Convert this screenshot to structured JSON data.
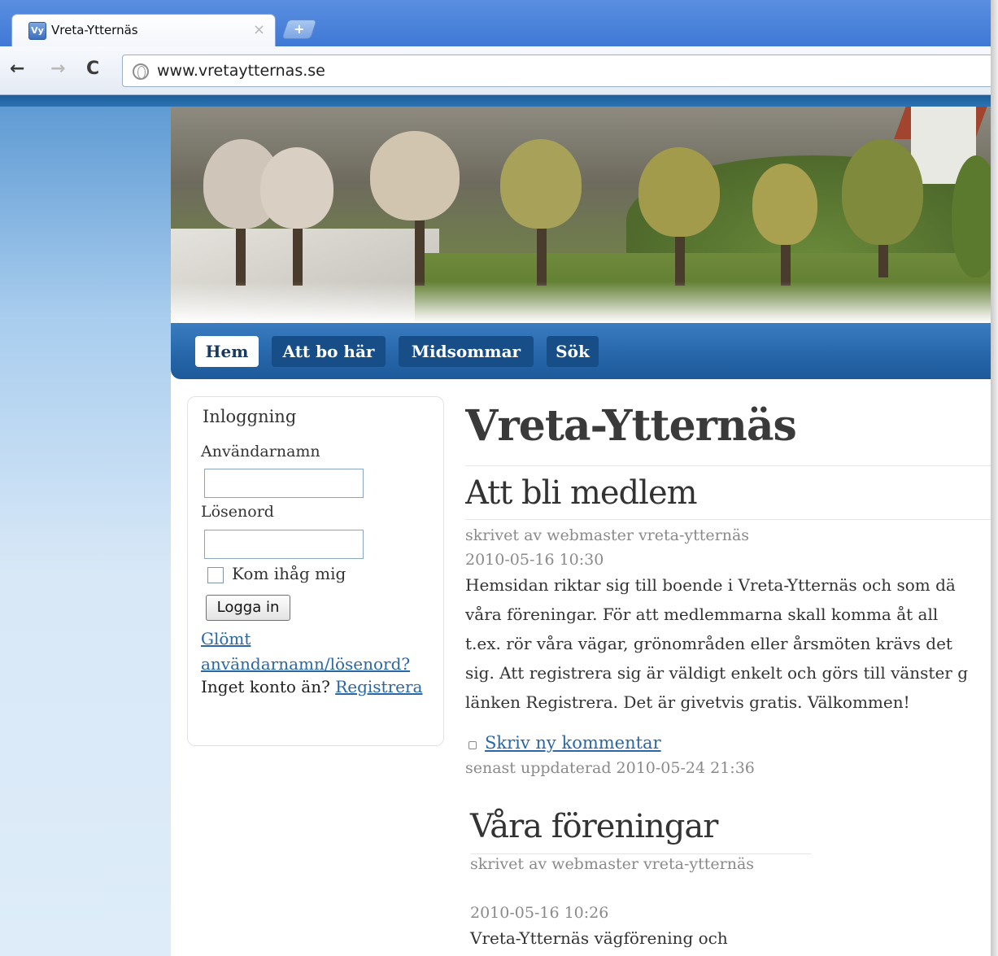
{
  "browser": {
    "tab_title": "Vreta-Ytternäs",
    "tab_close": "×",
    "new_tab": "+",
    "url": "www.vretaytternas.se",
    "favicon_text": "Vy"
  },
  "nav": {
    "items": [
      {
        "label": "Hem",
        "active": true
      },
      {
        "label": "Att bo här",
        "active": false
      },
      {
        "label": "Midsommar",
        "active": false
      },
      {
        "label": "Sök",
        "active": false
      }
    ]
  },
  "login": {
    "title": "Inloggning",
    "username_label": "Användarnamn",
    "username_value": "",
    "password_label": "Lösenord",
    "password_value": "",
    "remember_label": "Kom ihåg mig",
    "remember_checked": false,
    "button_label": "Logga in",
    "forgot_line1": "Glömt",
    "forgot_line2": "användarnamn/lösenord?",
    "no_account": "Inget konto än?",
    "register_link": "Registrera"
  },
  "main": {
    "site_title": "Vreta-Ytternäs",
    "articles": [
      {
        "title": "Att bli medlem",
        "author": "skrivet av webmaster vreta-ytternäs",
        "date": "2010-05-16 10:30",
        "body": [
          "Hemsidan riktar sig till boende i Vreta-Ytternäs och som dä",
          "våra föreningar. För att medlemmarna skall komma åt all",
          "t.ex. rör våra vägar, grönområden eller årsmöten krävs det",
          "sig. Att registrera sig är väldigt enkelt och görs till vänster g",
          "länken Registrera. Det är givetvis gratis. Välkommen!"
        ],
        "comment_link": "Skriv ny kommentar",
        "updated": "senast uppdaterad 2010-05-24 21:36"
      },
      {
        "title": "Våra föreningar",
        "author": "skrivet av webmaster vreta-ytternäs",
        "date": "2010-05-16 10:26",
        "body": [
          "Vreta-Ytternäs vägförening och"
        ]
      }
    ]
  },
  "colors": {
    "nav_bar": "#2565a8",
    "nav_item": "#174e88",
    "link": "#2a67a6",
    "browser_frame": "#3f79d6"
  }
}
